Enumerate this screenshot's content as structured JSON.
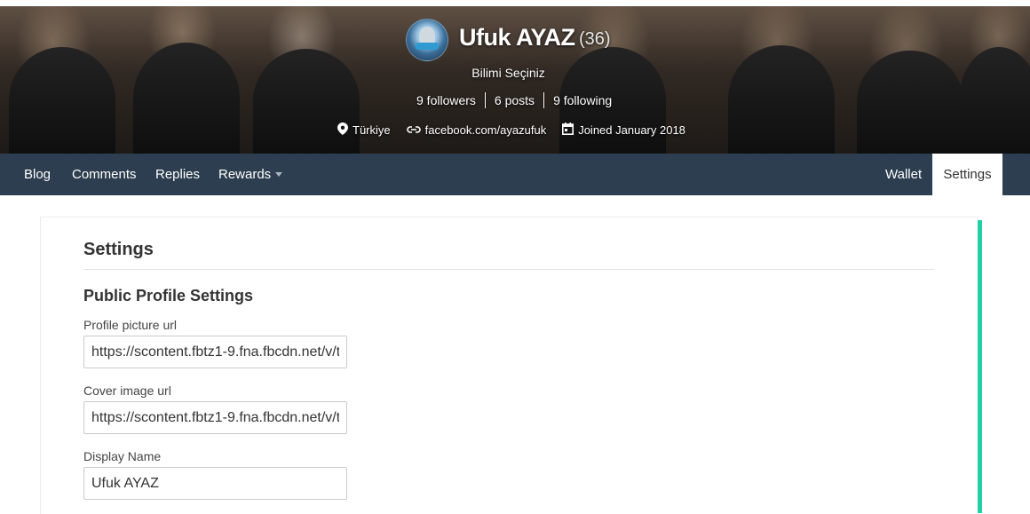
{
  "profile": {
    "name": "Ufuk AYAZ",
    "reputation": "(36)",
    "about": "Bilimi Seçiniz",
    "followers": "9 followers",
    "posts": "6 posts",
    "following": "9 following",
    "location": "Türkiye",
    "website": "facebook.com/ayazufuk",
    "joined": "Joined January 2018"
  },
  "nav": {
    "left": [
      "Blog",
      "Comments",
      "Replies",
      "Rewards"
    ],
    "right": [
      "Wallet",
      "Settings"
    ],
    "active": "Settings"
  },
  "settings": {
    "title": "Settings",
    "section": "Public Profile Settings",
    "fields": [
      {
        "label": "Profile picture url",
        "value": "https://scontent.fbtz1-9.fna.fbcdn.net/v/t"
      },
      {
        "label": "Cover image url",
        "value": "https://scontent.fbtz1-9.fna.fbcdn.net/v/t"
      },
      {
        "label": "Display Name",
        "value": "Ufuk AYAZ"
      }
    ]
  },
  "icons": {
    "location": "map-pin-icon",
    "website": "link-icon",
    "joined": "calendar-icon",
    "rewards_caret": "caret-down-icon"
  },
  "colors": {
    "navbar": "#2c3e4f",
    "accent": "#1fd1a4",
    "active_tab": "#ffffff"
  }
}
